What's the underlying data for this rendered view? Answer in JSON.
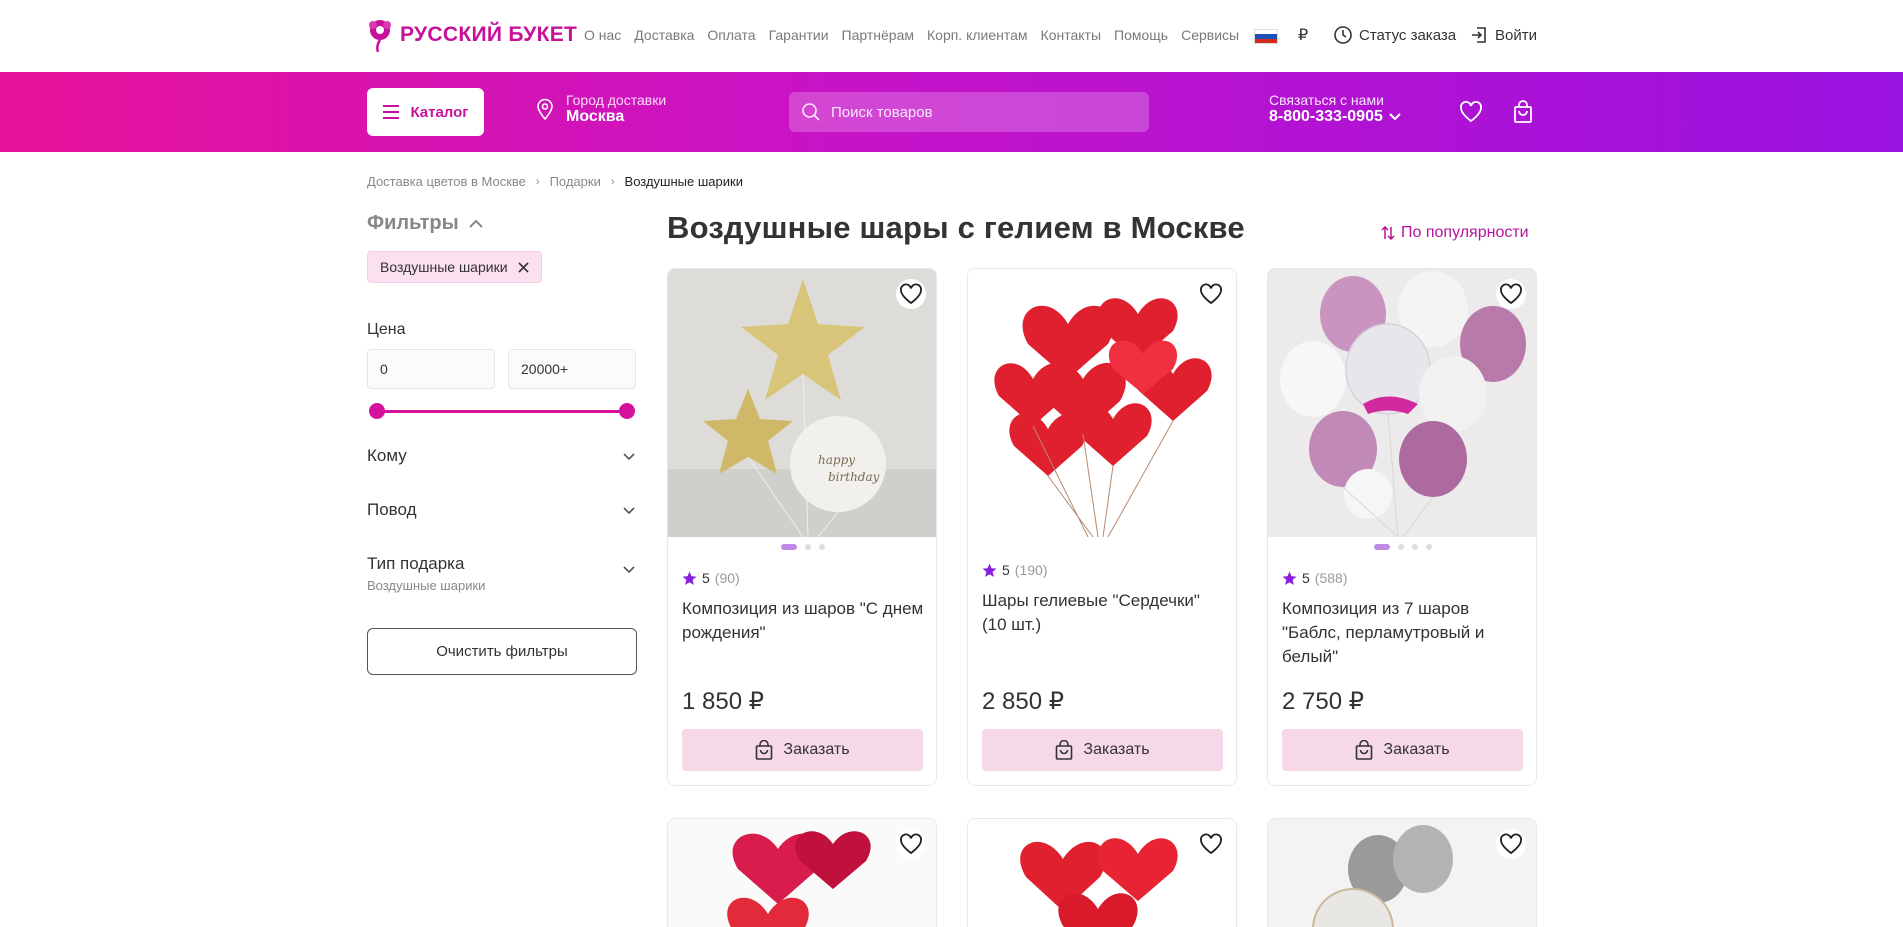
{
  "brand": {
    "name": "РУССКИЙ БУКЕТ",
    "color": "#c7119b"
  },
  "topnav": {
    "items": [
      "О нас",
      "Доставка",
      "Оплата",
      "Гарантии",
      "Партнёрам",
      "Корп. клиентам",
      "Контакты",
      "Помощь",
      "Сервисы"
    ]
  },
  "currency": "₽",
  "order_status": "Статус заказа",
  "login": "Войти",
  "header": {
    "catalog": "Каталог",
    "city_label": "Город доставки",
    "city": "Москва",
    "search_placeholder": "Поиск товаров",
    "contact_label": "Связаться с нами",
    "phone": "8-800-333-0905",
    "gradient": [
      "#e8139a",
      "#c613c8",
      "#9a12e0"
    ]
  },
  "breadcrumb": [
    "Доставка цветов в Москве",
    "Подарки",
    "Воздушные шарики"
  ],
  "filters": {
    "title": "Фильтры",
    "chip": "Воздушные шарики",
    "price_label": "Цена",
    "price_min": "0",
    "price_max": "20000+",
    "facets": [
      {
        "label": "Кому",
        "sub": ""
      },
      {
        "label": "Повод",
        "sub": ""
      },
      {
        "label": "Тип подарка",
        "sub": "Воздушные шарики"
      }
    ],
    "clear": "Очистить фильтры"
  },
  "main": {
    "title": "Воздушные шары с гелием в Москве",
    "sort": "По популярности"
  },
  "products": [
    {
      "name": "Композиция из шаров \"С днем рождения\"",
      "rating": "5",
      "reviews": "(90)",
      "price": "1 850 ₽",
      "cta": "Заказать",
      "dots": 3
    },
    {
      "name": "Шары гелиевые \"Сердечки\" (10 шт.)",
      "rating": "5",
      "reviews": "(190)",
      "price": "2 850 ₽",
      "cta": "Заказать",
      "dots": 0
    },
    {
      "name": "Композиция из 7 шаров \"Баблс, перламутровый и белый\"",
      "rating": "5",
      "reviews": "(588)",
      "price": "2 750 ₽",
      "cta": "Заказать",
      "dots": 4
    }
  ]
}
